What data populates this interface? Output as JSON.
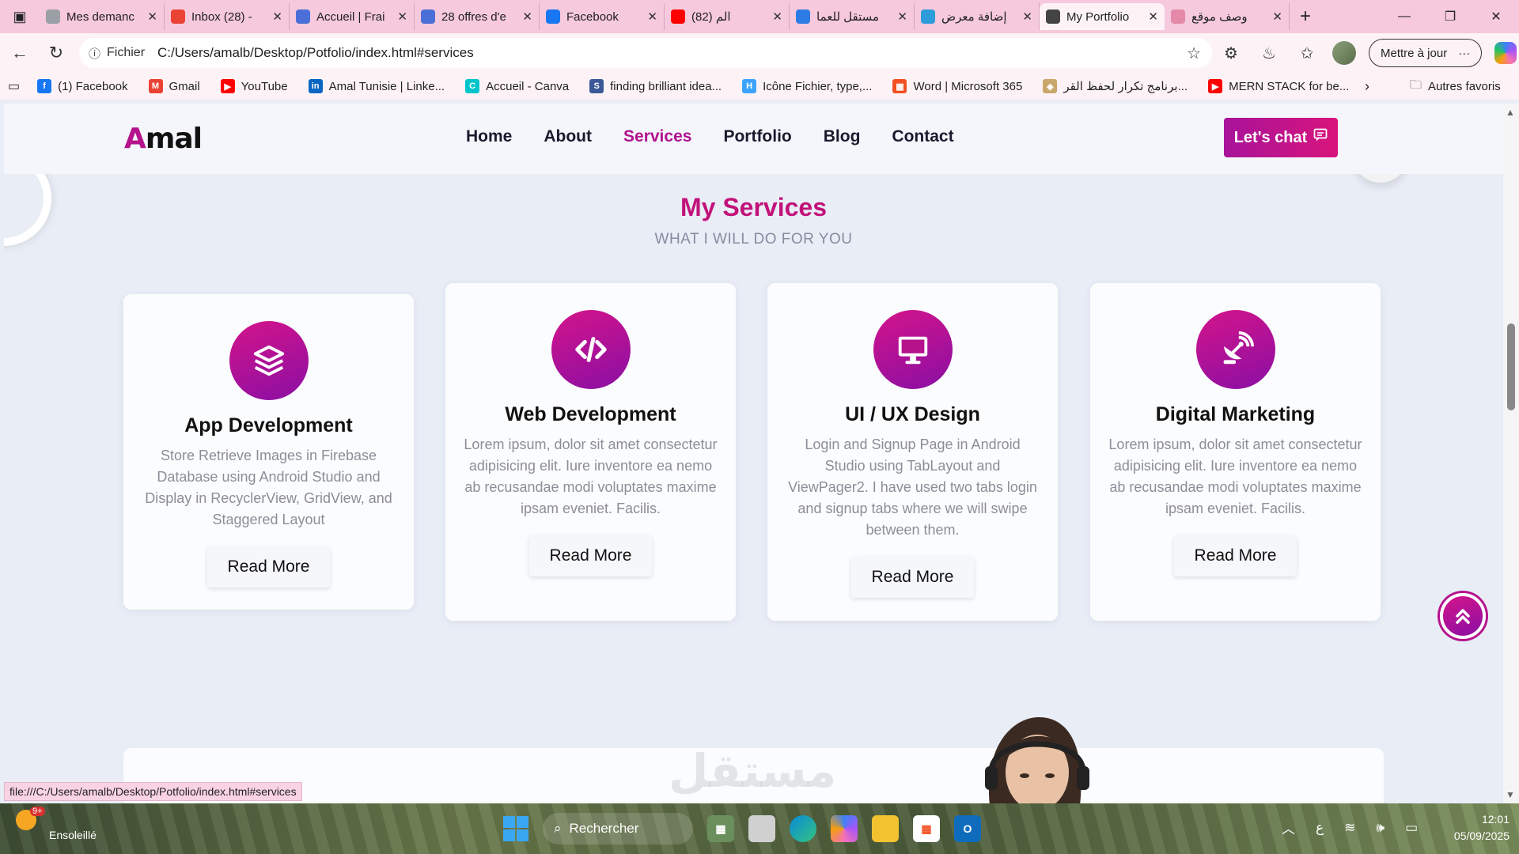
{
  "browser": {
    "tabs": [
      {
        "title": "Mes demanc",
        "icon": "gear-icon",
        "color": "#9aa0a6"
      },
      {
        "title": "Inbox (28) -",
        "icon": "gmail-icon",
        "color": "#ea4335"
      },
      {
        "title": "Accueil | Frai",
        "icon": "puzzle-icon",
        "color": "#4a6fd8"
      },
      {
        "title": "28 offres d'e",
        "icon": "puzzle-icon",
        "color": "#4a6fd8"
      },
      {
        "title": "Facebook",
        "icon": "facebook-icon",
        "color": "#1877f2"
      },
      {
        "title": "(82) الم",
        "icon": "youtube-icon",
        "color": "#ff0000"
      },
      {
        "title": "مستقل للعما",
        "icon": "search-icon",
        "color": "#2d7be5"
      },
      {
        "title": "إضافة معرض",
        "icon": "circle-icon",
        "color": "#2d9cdb"
      },
      {
        "title": "My Portfolio",
        "icon": "globe-icon",
        "color": "#444444",
        "active": true
      },
      {
        "title": "وصف موقع",
        "icon": "openai-icon",
        "color": "#e48aa8"
      }
    ],
    "url_scheme": "Fichier",
    "url": "C:/Users/amalb/Desktop/Potfolio/index.html#services",
    "update_button": "Mettre à jour",
    "bookmarks": [
      {
        "label": "(1) Facebook",
        "color": "#1877f2",
        "glyph": "f"
      },
      {
        "label": "Gmail",
        "color": "#ea4335",
        "glyph": "M"
      },
      {
        "label": "YouTube",
        "color": "#ff0000",
        "glyph": "▶"
      },
      {
        "label": "Amal Tunisie | Linke...",
        "color": "#0a66c2",
        "glyph": "in"
      },
      {
        "label": "Accueil - Canva",
        "color": "#00c4cc",
        "glyph": "C"
      },
      {
        "label": "finding brilliant idea...",
        "color": "#3b5998",
        "glyph": "S"
      },
      {
        "label": "Icône Fichier, type,...",
        "color": "#3ba3ff",
        "glyph": "H"
      },
      {
        "label": "Word | Microsoft 365",
        "color": "#f25022",
        "glyph": "▦"
      },
      {
        "label": "برنامج تكرار لحفظ القر...",
        "color": "#c9a66b",
        "glyph": "◈"
      },
      {
        "label": "MERN STACK for be...",
        "color": "#ff0000",
        "glyph": "▶"
      }
    ],
    "other_bookmarks": "Autres favoris",
    "status_url": "file:///C:/Users/amalb/Desktop/Potfolio/index.html#services"
  },
  "site": {
    "logo_first": "A",
    "logo_rest": "mal",
    "nav": [
      "Home",
      "About",
      "Services",
      "Portfolio",
      "Blog",
      "Contact"
    ],
    "nav_active": "Services",
    "chat_button": "Let's chat",
    "section_title": "My Services",
    "section_subtitle": "WHAT I WILL DO FOR YOU",
    "services": [
      {
        "title": "App Development",
        "icon": "layers-icon",
        "text": "Store Retrieve Images in Firebase Database using Android Studio and Display in RecyclerView, GridView, and Staggered Layout",
        "button": "Read More"
      },
      {
        "title": "Web Development",
        "icon": "code-icon",
        "text": "Lorem ipsum, dolor sit amet consectetur adipisicing elit. Iure inventore ea nemo ab recusandae modi voluptates maxime ipsam eveniet. Facilis.",
        "button": "Read More"
      },
      {
        "title": "UI / UX Design",
        "icon": "monitor-icon",
        "text": "Login and Signup Page in Android Studio using TabLayout and ViewPager2. I have used two tabs login and signup tabs where we will swipe between them.",
        "button": "Read More"
      },
      {
        "title": "Digital Marketing",
        "icon": "satellite-dish-icon",
        "text": "Lorem ipsum, dolor sit amet consectetur adipisicing elit. Iure inventore ea nemo ab recusandae modi voluptates maxime ipsam eveniet. Facilis.",
        "button": "Read More"
      }
    ],
    "watermark": "مستقل"
  },
  "taskbar": {
    "weather_badge": "9+",
    "weather_text": "Ensoleillé",
    "search": "Rechercher",
    "lang": "ع",
    "time": "12:01",
    "date": "05/09/2025"
  },
  "colors": {
    "accent": "#b5128c",
    "accent2": "#d8147c",
    "tabbar": "#f6c9dd"
  }
}
